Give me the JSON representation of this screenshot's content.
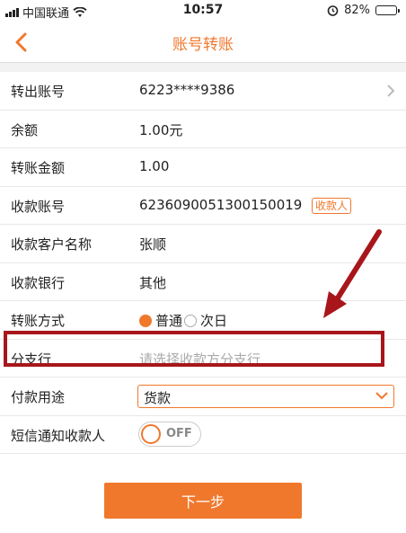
{
  "status_bar": {
    "carrier": "中国联通",
    "time": "10:57",
    "battery": "82%",
    "battery_level": 0.82,
    "icons": [
      "signal-icon",
      "wifi-icon",
      "alarm-icon",
      "battery-icon"
    ]
  },
  "nav": {
    "title": "账号转账",
    "back_icon": "chevron-left-icon"
  },
  "colors": {
    "accent": "#f0782d",
    "highlight": "#a8161b"
  },
  "form": {
    "from_account": {
      "label": "转出账号",
      "value": "6223****9386"
    },
    "balance": {
      "label": "余额",
      "value": "1.00元"
    },
    "amount": {
      "label": "转账金额",
      "value": "1.00"
    },
    "payee_account": {
      "label": "收款账号",
      "value": "6236090051300150019",
      "tag": "收款人"
    },
    "payee_name": {
      "label": "收款客户名称",
      "value": "张顺"
    },
    "payee_bank": {
      "label": "收款银行",
      "value": "其他"
    },
    "method": {
      "label": "转账方式",
      "options": [
        "普通",
        "次日"
      ],
      "selected": "普通"
    },
    "branch": {
      "label": "分支行",
      "placeholder": "请选择收款方分支行"
    },
    "purpose": {
      "label": "付款用途",
      "value": "货款"
    },
    "sms": {
      "label": "短信通知收款人",
      "toggle": "OFF"
    }
  },
  "actions": {
    "next": "下一步"
  }
}
